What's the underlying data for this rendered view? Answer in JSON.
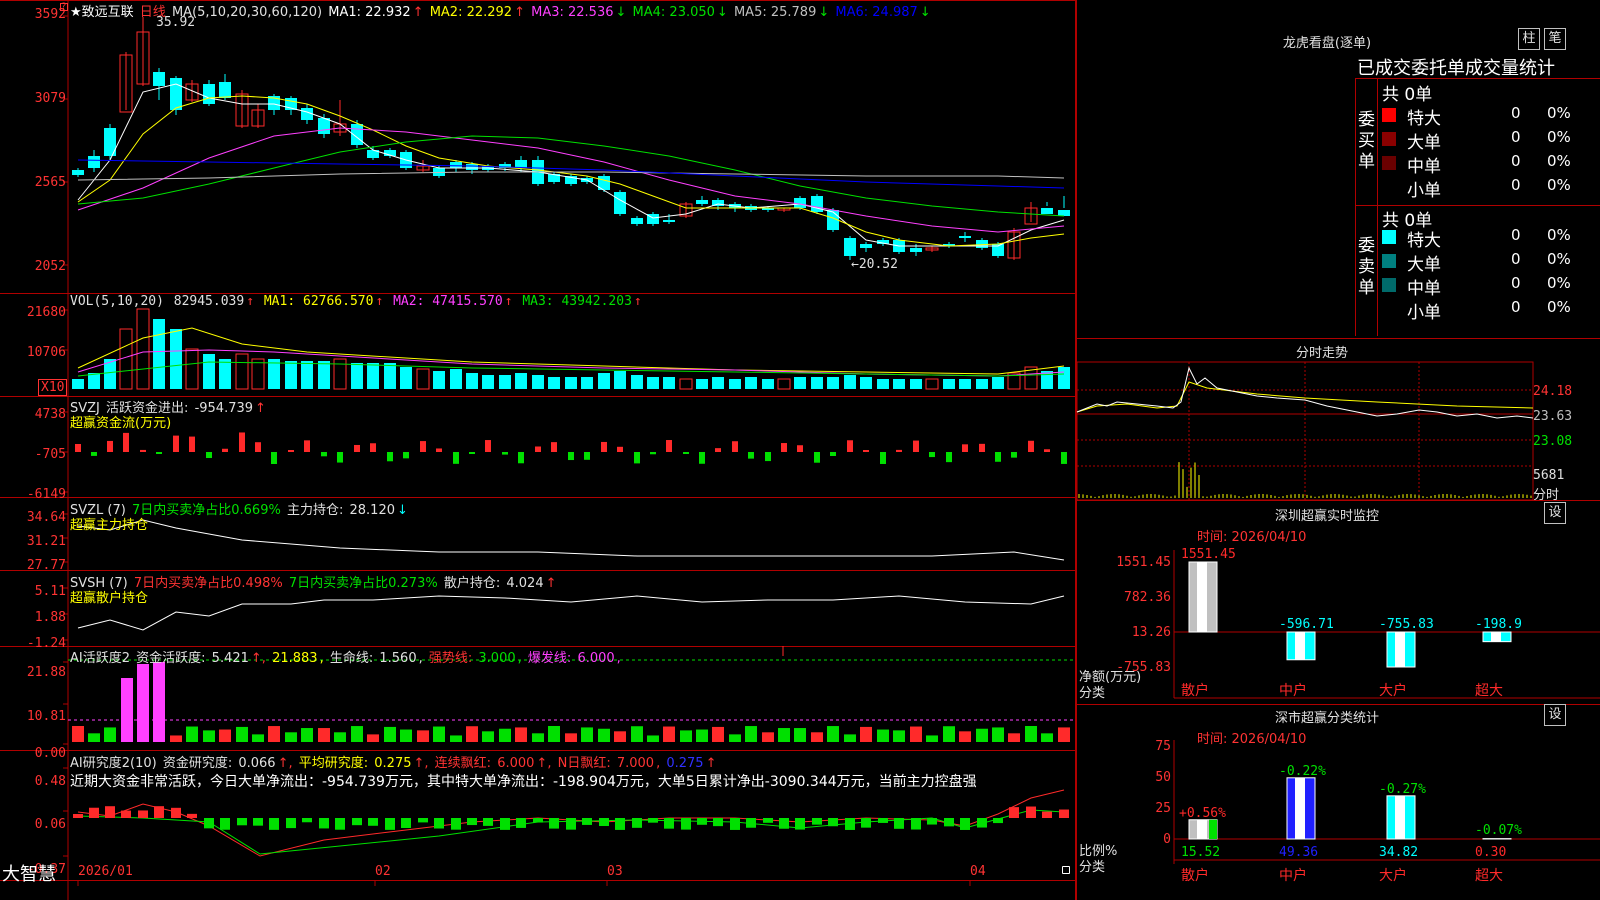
{
  "app": {
    "brand": "大智慧"
  },
  "stock": {
    "name": "★致远互联",
    "period": "日线"
  },
  "colors": {
    "up": "#ff2a2a",
    "down": "#00ffff",
    "green": "#00e000",
    "magenta": "#ff40ff",
    "yellow": "#ffff00",
    "white": "#ffffff",
    "grid": "#b00000",
    "label": "#ff3333"
  },
  "price_panel": {
    "ma_legend": "MA(5,10,20,30,60,120)",
    "ma": [
      {
        "name": "MA1",
        "value": "22.932",
        "arrow": "↑",
        "color": "#ffffff"
      },
      {
        "name": "MA2",
        "value": "22.292",
        "arrow": "↑",
        "color": "#ffff00"
      },
      {
        "name": "MA3",
        "value": "22.536",
        "arrow": "↓",
        "color": "#ff40ff"
      },
      {
        "name": "MA4",
        "value": "23.050",
        "arrow": "↓",
        "color": "#00e000"
      },
      {
        "name": "MA5",
        "value": "25.789",
        "arrow": "↓",
        "color": "#c0c0c0"
      },
      {
        "name": "MA6",
        "value": "24.987",
        "arrow": "↓",
        "color": "#0000ff"
      }
    ],
    "y_labels": [
      "3592",
      "3079",
      "2565",
      "2052"
    ],
    "high_label": "35.92",
    "low_label": "←20.52"
  },
  "vol_panel": {
    "legend": "VOL(5,10,20)",
    "value": "82945.039",
    "arrow": "↑",
    "ma": [
      {
        "name": "MA1",
        "value": "62766.570",
        "arrow": "↑",
        "color": "#ffff00"
      },
      {
        "name": "MA2",
        "value": "47415.570",
        "arrow": "↑",
        "color": "#ff40ff"
      },
      {
        "name": "MA3",
        "value": "43942.203",
        "arrow": "↑",
        "color": "#00e000"
      }
    ],
    "y_labels": [
      "21680",
      "10706"
    ],
    "unit": "X10"
  },
  "svzj_panel": {
    "legend": "SVZJ",
    "item": "活跃资金进出:",
    "value": "-954.739",
    "arrow": "↑",
    "subtitle": "超赢资金流(万元)",
    "y_labels": [
      "4738",
      "-705",
      "-6149"
    ]
  },
  "svzl_panel": {
    "legend": "SVZL (7)",
    "item1": "7日内买卖净占比0.669%",
    "item2": "主力持仓:",
    "value": "28.120",
    "arrow": "↓",
    "subtitle": "超赢主力持仓",
    "y_labels": [
      "34.64",
      "31.21",
      "27.77"
    ]
  },
  "svsh_panel": {
    "legend": "SVSH (7)",
    "item1": "7日内买卖净占比0.498%",
    "item2": "7日内买卖净占比0.273%",
    "item3": "散户持仓:",
    "value": "4.024",
    "arrow": "↑",
    "subtitle": "超赢散户持仓",
    "y_labels": [
      "5.11",
      "1.88",
      "-1.24"
    ]
  },
  "ai_active_panel": {
    "legend": "AI活跃度2",
    "item1": "资金活跃度:",
    "v1": "5.421",
    "v2": "21.883",
    "item3": "生命线:",
    "v3": "1.560",
    "item4": "强势线:",
    "v4": "3.000",
    "item5": "爆发线:",
    "v5": "6.000",
    "y_labels": [
      "21.88",
      "10.81",
      "0.00"
    ]
  },
  "ai_research_panel": {
    "legend": "AI研究度2(10)",
    "item1": "资金研究度:",
    "v1": "0.066",
    "item2": "平均研究度:",
    "v2": "0.275",
    "item3": "连续飘红:",
    "v3": "6.000",
    "item4": "N日飘红:",
    "v4": "7.000",
    "v5": "0.275",
    "summary": "近期大资金非常活跃，今日大单净流出：-954.739万元，其中特大单净流出：-198.904万元，大单5日累计净出-3090.344万元，当前主力控盘强",
    "y_labels": [
      "0.48",
      "0.06",
      "-0.37"
    ]
  },
  "x_axis": [
    "2026/01",
    "02",
    "03",
    "04"
  ],
  "dragon_tiger": {
    "title": "龙虎看盘(逐单)",
    "btn1": "柱",
    "btn2": "笔",
    "subtitle": "已成交委托单成交量统计",
    "buy_label": "委买单",
    "buy_total": "共 0单",
    "sell_label": "委卖单",
    "sell_total": "共 0单",
    "buy_rows": [
      {
        "label": "特大",
        "count": "0",
        "pct": "0%",
        "color": "#ff0000"
      },
      {
        "label": "大单",
        "count": "0",
        "pct": "0%",
        "color": "#8b0000"
      },
      {
        "label": "中单",
        "count": "0",
        "pct": "0%",
        "color": "#6a0000"
      },
      {
        "label": "小单",
        "count": "0",
        "pct": "0%",
        "color": ""
      }
    ],
    "sell_rows": [
      {
        "label": "特大",
        "count": "0",
        "pct": "0%",
        "color": "#00ffff"
      },
      {
        "label": "大单",
        "count": "0",
        "pct": "0%",
        "color": "#008080"
      },
      {
        "label": "中单",
        "count": "0",
        "pct": "0%",
        "color": "#006a6a"
      },
      {
        "label": "小单",
        "count": "0",
        "pct": "0%",
        "color": ""
      }
    ]
  },
  "intraday": {
    "title": "分时走势",
    "y_labels": [
      "24.18",
      "23.63",
      "23.08"
    ],
    "vol_label": "5681",
    "vol_unit": "分时"
  },
  "monitor": {
    "title": "深圳超赢实时监控",
    "btn": "设",
    "time": "时间: 2026/04/10",
    "y_labels": [
      "1551.45",
      "782.36",
      "13.26",
      "-755.83"
    ],
    "ylabel": "净额(万元)",
    "xlabel": "分类",
    "chart_data": {
      "type": "bar",
      "categories": [
        "散户",
        "中户",
        "大户",
        "超大"
      ],
      "values": [
        1551.45,
        -596.71,
        -755.83,
        -198.9
      ],
      "labels": [
        "1551.45",
        "-596.71",
        "-755.83",
        "-198.9"
      ],
      "ylim": [
        -755.83,
        1551.45
      ]
    }
  },
  "classify": {
    "title": "深市超赢分类统计",
    "btn": "设",
    "time": "时间: 2026/04/10",
    "y_labels": [
      "75",
      "50",
      "25",
      "0"
    ],
    "ylabel": "比例%",
    "xlabel": "分类",
    "chart_data": {
      "type": "bar",
      "categories": [
        "散户",
        "中户",
        "大户",
        "超大"
      ],
      "values": [
        15.52,
        49.36,
        34.82,
        0.3
      ],
      "labels": [
        "15.52",
        "49.36",
        "34.82",
        "0.30"
      ],
      "changes": [
        "+0.56%",
        "-0.22%",
        "-0.27%",
        "-0.07%"
      ],
      "ylim": [
        0,
        75
      ]
    }
  }
}
